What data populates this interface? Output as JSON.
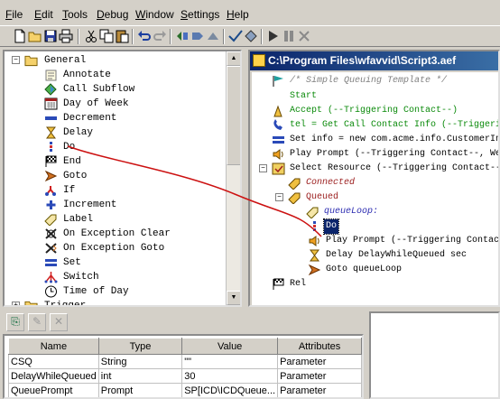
{
  "menu": [
    {
      "key": "F",
      "rest": "ile"
    },
    {
      "key": "E",
      "rest": "dit"
    },
    {
      "key": "T",
      "rest": "ools"
    },
    {
      "key": "D",
      "rest": "ebug"
    },
    {
      "key": "W",
      "rest": "indow"
    },
    {
      "key": "S",
      "rest": "ettings"
    },
    {
      "key": "H",
      "rest": "elp"
    }
  ],
  "palette": {
    "root": "General",
    "items": [
      "Annotate",
      "Call Subflow",
      "Day of Week",
      "Decrement",
      "Delay",
      "Do",
      "End",
      "Goto",
      "If",
      "Increment",
      "Label",
      "On Exception Clear",
      "On Exception Goto",
      "Set",
      "Switch",
      "Time of Day"
    ],
    "next_group": "Trigger"
  },
  "designer": {
    "title": "C:\\Program Files\\wfavvid\\Script3.aef",
    "lines": {
      "comment": "/* Simple Queuing Template */",
      "start": "Start",
      "accept": "Accept (--Triggering Contact--)",
      "get_call": "tel = Get Call Contact Info (--Triggeri",
      "set_info": "Set info = new com.acme.info.CustomerIn",
      "play_prompt": "Play Prompt (--Triggering Contact--, We",
      "select_resource": "Select Resource (--Triggering Contact--",
      "connected": "Connected",
      "queued": "Queued",
      "queue_loop_label": "queueLoop:",
      "do": "Do",
      "play_prompt2": "Play Prompt (--Triggering Contact",
      "delay": "Delay DelayWhileQueued sec",
      "goto": "Goto queueLoop",
      "partial": "Rel"
    }
  },
  "variables": {
    "columns": [
      "Name",
      "Type",
      "Value",
      "Attributes"
    ],
    "rows": [
      [
        "CSQ",
        "String",
        "\"\"",
        "Parameter"
      ],
      [
        "DelayWhileQueued",
        "int",
        "30",
        "Parameter"
      ],
      [
        "QueuePrompt",
        "Prompt",
        "SP[ICD\\ICDQueue...",
        "Parameter"
      ]
    ]
  },
  "colors": {
    "title_start": "#0a246a",
    "title_end": "#3a6ea5",
    "drag_line": "#cc1111",
    "selection": "#0a246a"
  }
}
